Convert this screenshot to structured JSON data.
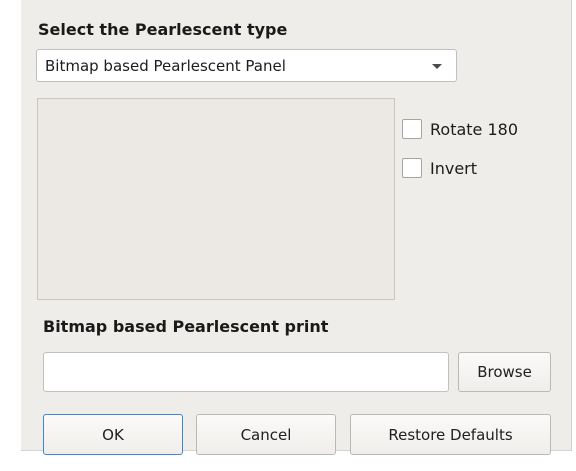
{
  "dialog": {
    "heading": "Select the Pearlescent type",
    "type_select": {
      "value": "Bitmap based Pearlescent Panel"
    },
    "options": {
      "rotate_label": "Rotate 180",
      "invert_label": "Invert"
    },
    "print_section": {
      "heading": "Bitmap based Pearlescent print",
      "path_value": "",
      "browse_label": "Browse"
    },
    "buttons": {
      "ok_label": "OK",
      "cancel_label": "Cancel",
      "restore_label": "Restore Defaults"
    }
  }
}
